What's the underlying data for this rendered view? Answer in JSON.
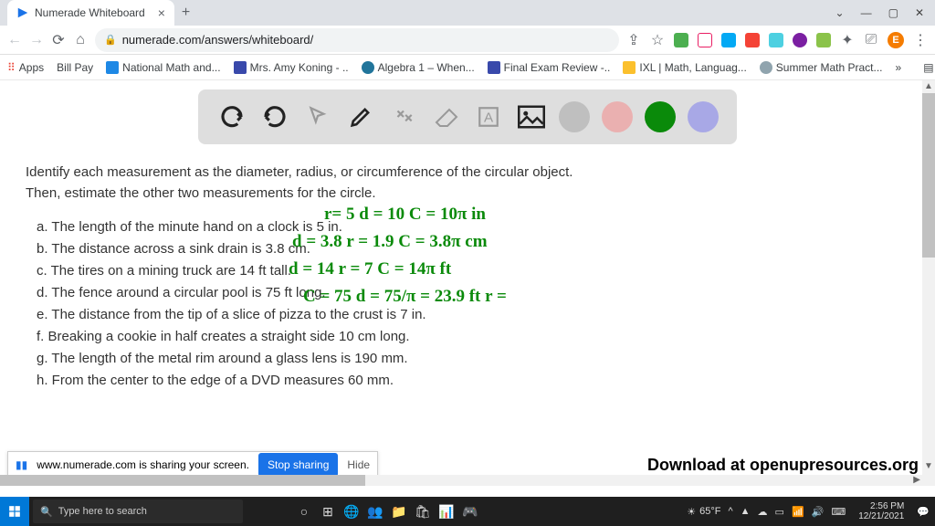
{
  "window": {
    "tab_title": "Numerade Whiteboard"
  },
  "url": "numerade.com/answers/whiteboard/",
  "bookmarks": {
    "apps": "Apps",
    "items": [
      {
        "label": "Bill Pay",
        "color": "#fff"
      },
      {
        "label": "National Math and...",
        "color": "#1e88e5"
      },
      {
        "label": "Mrs. Amy Koning - ..",
        "color": "#3949ab"
      },
      {
        "label": "Algebra 1 – When...",
        "color": "#21759b"
      },
      {
        "label": "Final Exam Review -..",
        "color": "#3949ab"
      },
      {
        "label": "IXL | Math, Languag...",
        "color": "#fbc02d"
      },
      {
        "label": "Summer Math Pract...",
        "color": "#90a4ae"
      }
    ],
    "reading": "Reading list"
  },
  "prompt": {
    "line1": "Identify each measurement as the diameter, radius, or circumference of the circular object.",
    "line2": "Then, estimate the other two measurements for the circle."
  },
  "items": {
    "a": "a. The length of the minute hand on a clock is 5 in.",
    "b": "b. The distance across a sink drain is 3.8 cm.",
    "c": "c. The tires on a mining truck are 14 ft tall.",
    "d": "d. The fence around a circular pool is 75 ft long.",
    "e": "e. The distance from the tip of a slice of pizza to the crust is 7 in.",
    "f": " f. Breaking a cookie in half creates a straight side 10 cm long.",
    "g": "g. The length of the metal rim around a glass lens is 190 mm.",
    "h": "h. From the center to the edge of a DVD measures 60 mm."
  },
  "hand": {
    "a": "r= 5   d = 10   C = 10π in",
    "b": "d = 3.8    r = 1.9   C = 3.8π cm",
    "c": "d = 14    r = 7     C = 14π ft",
    "d": "C = 75   d = 75/π =  23.9 ft   r ="
  },
  "toolbar_colors": {
    "gray": "#bfbfbf",
    "pink": "#eab0b0",
    "green": "#0a8a0a",
    "purple": "#a8a8e6"
  },
  "share": {
    "msg": "www.numerade.com is sharing your screen.",
    "stop": "Stop sharing",
    "hide": "Hide"
  },
  "download": "Download at openupresources.org",
  "taskbar": {
    "search": "Type here to search",
    "weather": "65°F",
    "time": "2:56 PM",
    "date": "12/21/2021"
  }
}
